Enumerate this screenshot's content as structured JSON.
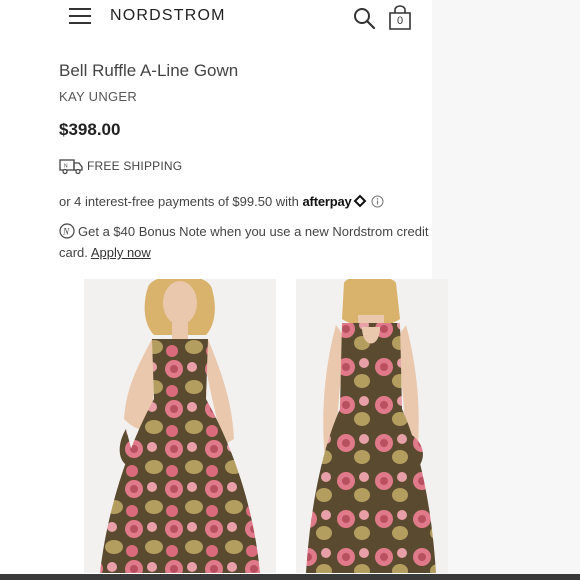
{
  "header": {
    "logo": "NORDSTROM",
    "bag_count": "0"
  },
  "product": {
    "title": "Bell Ruffle A-Line Gown",
    "brand": "KAY UNGER",
    "price": "$398.00",
    "shipping": "FREE SHIPPING",
    "installments_prefix": "or 4 interest-free payments of $99.50 with",
    "afterpay_label": "afterpay",
    "bonus_text": "Get a $40 Bonus Note when you use a new Nordstrom credit card.",
    "apply_link": "Apply now"
  },
  "images": [
    {
      "view": "front"
    },
    {
      "view": "back"
    }
  ],
  "colors": {
    "dress_base": "#5a4a30",
    "flower_pink": "#e07a8a",
    "gold": "#c9b26a",
    "skin": "#e9c8ad",
    "hair": "#d9b26b"
  }
}
